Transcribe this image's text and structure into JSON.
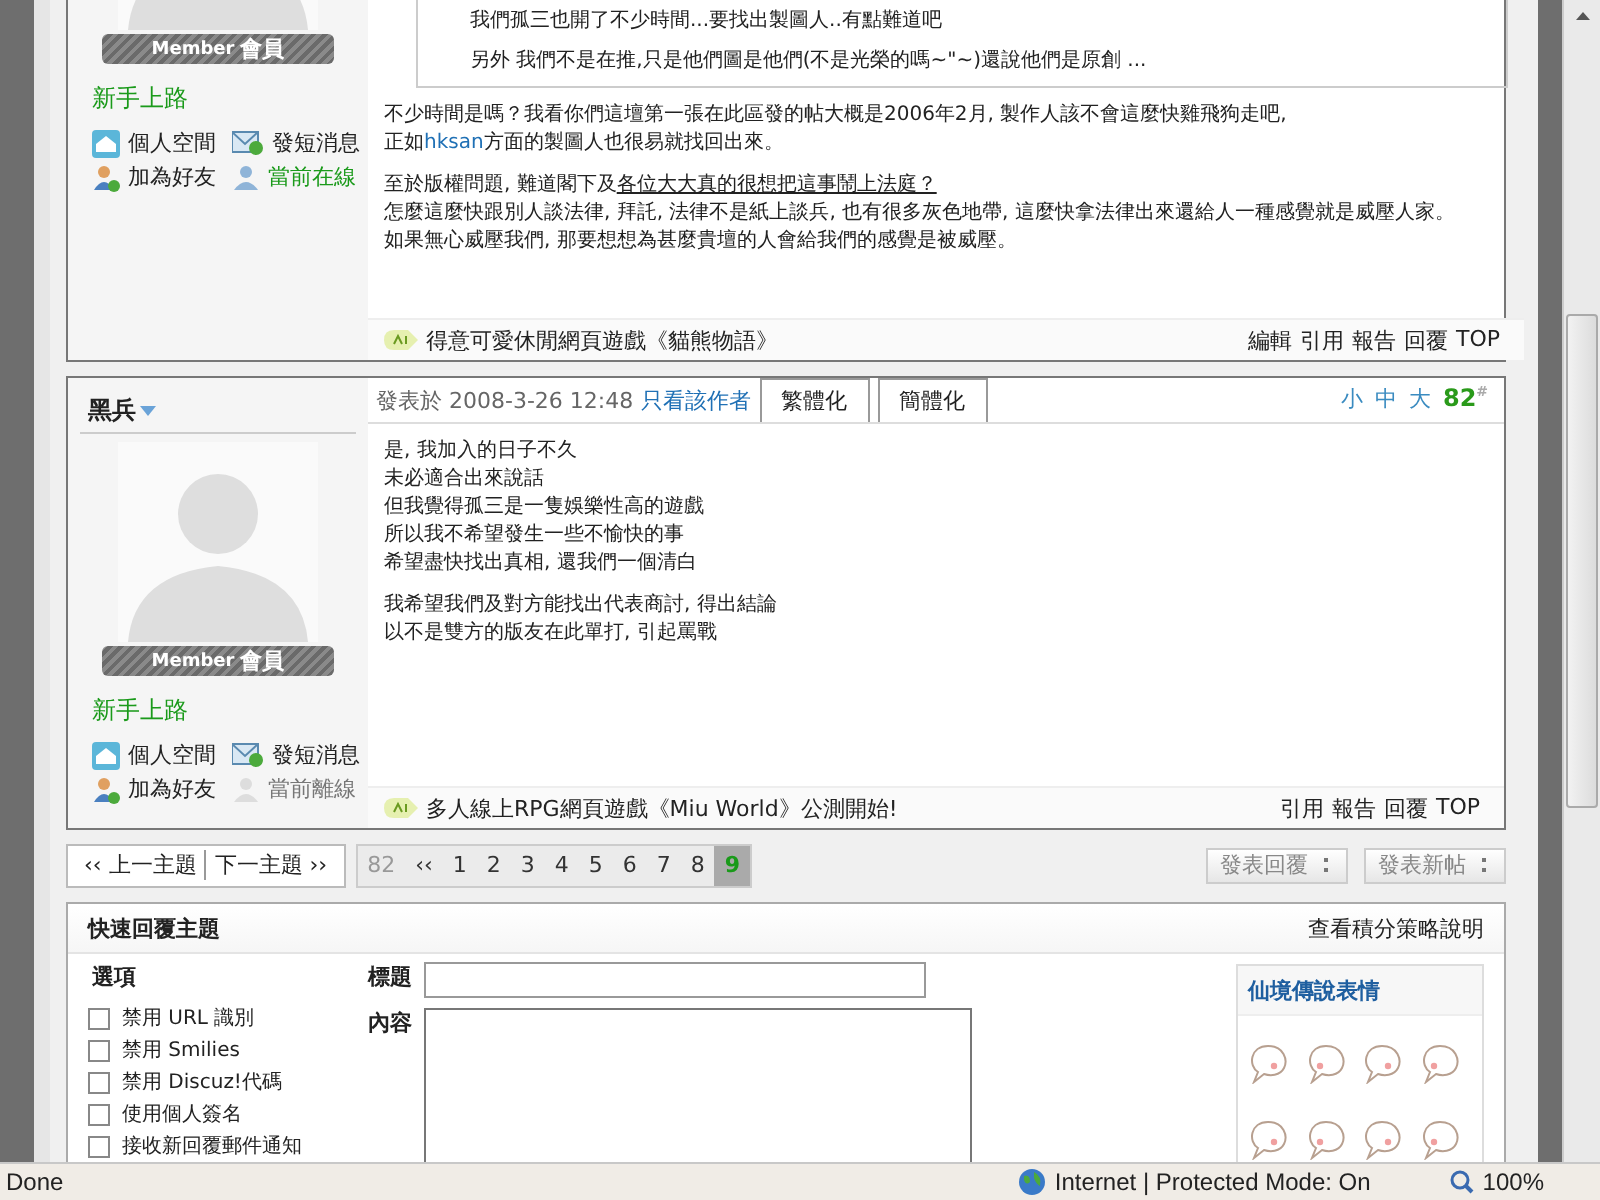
{
  "posts": [
    {
      "sidebar": {
        "badge_role": "Member",
        "badge_label": "會員",
        "rank": "新手上路",
        "links": [
          {
            "kind": "space",
            "label": "個人空間"
          },
          {
            "kind": "message",
            "label": "發短消息"
          },
          {
            "kind": "friend",
            "label": "加為好友"
          },
          {
            "kind": "status",
            "label": "當前在線",
            "online": true
          }
        ]
      },
      "quote_lines": [
        "我們孤三也開了不少時間...要找出製圖人..有點難道吧",
        "另外 我們不是在推,只是他們圖是他們(不是光榮的嗎~\"~)還說他們是原創 ..."
      ],
      "paragraphs": [
        [
          [
            {
              "kind": "text",
              "text": "不少時間是嗎？我看你們這壇第一張在此區發的帖大概是2006年2月, 製作人該不會這麼快雞飛狗走吧,"
            }
          ],
          [
            {
              "kind": "text",
              "text": "正如"
            },
            {
              "kind": "highlight",
              "text": "hksan"
            },
            {
              "kind": "text",
              "text": "方面的製圖人也很易就找回出來。"
            }
          ]
        ],
        [
          [
            {
              "kind": "text",
              "text": "至於版權問題, 難道閣下及"
            },
            {
              "kind": "underline",
              "text": "各位大大真的很想把這事鬧上法庭？"
            }
          ],
          [
            {
              "kind": "text",
              "text": "怎麼這麼快跟別人談法律, 拜託, 法律不是紙上談兵, 也有很多灰色地帶, 這麼快拿法律出來還給人一種感覺就是威壓人家。"
            }
          ],
          [
            {
              "kind": "text",
              "text": "如果無心威壓我們, 那要想想為甚麼貴壇的人會給我們的感覺是被威壓。"
            }
          ]
        ]
      ],
      "ad": "得意可愛休閒網頁遊戲《貓熊物語》",
      "actions": [
        "編輯",
        "引用",
        "報告",
        "回覆",
        "TOP"
      ]
    },
    {
      "author": "黑兵",
      "posted": "發表於 2008-3-26 12:48",
      "author_only": "只看該作者",
      "convert_tabs": [
        "繁體化",
        "簡體化"
      ],
      "font_sizes": [
        "小",
        "中",
        "大"
      ],
      "floor": "82",
      "floor_mark": "#",
      "sidebar": {
        "badge_role": "Member",
        "badge_label": "會員",
        "rank": "新手上路",
        "links": [
          {
            "kind": "space",
            "label": "個人空間"
          },
          {
            "kind": "message",
            "label": "發短消息"
          },
          {
            "kind": "friend",
            "label": "加為好友"
          },
          {
            "kind": "status",
            "label": "當前離線",
            "online": false
          }
        ]
      },
      "paragraphs": [
        [
          [
            {
              "kind": "text",
              "text": "是, 我加入的日子不久"
            }
          ],
          [
            {
              "kind": "text",
              "text": "未必適合出來說話"
            }
          ],
          [
            {
              "kind": "text",
              "text": "但我覺得孤三是一隻娛樂性高的遊戲"
            }
          ],
          [
            {
              "kind": "text",
              "text": "所以我不希望發生一些不愉快的事"
            }
          ],
          [
            {
              "kind": "text",
              "text": "希望盡快找出真相, 還我們一個清白"
            }
          ]
        ],
        [
          [
            {
              "kind": "text",
              "text": "我希望我們及對方能找出代表商討, 得出結論"
            }
          ],
          [
            {
              "kind": "text",
              "text": "以不是雙方的版友在此單打, 引起罵戰"
            }
          ]
        ]
      ],
      "ad": "多人線上RPG網頁遊戲《Miu World》公測開始!",
      "actions": [
        "引用",
        "報告",
        "回覆",
        "TOP"
      ]
    }
  ],
  "thread_nav": {
    "prev": "‹‹ 上一主題",
    "next": "下一主題 ››"
  },
  "pagination": {
    "total": "82",
    "first": "‹‹",
    "pages": [
      {
        "label": "1",
        "selected": false
      },
      {
        "label": "2",
        "selected": false
      },
      {
        "label": "3",
        "selected": false
      },
      {
        "label": "4",
        "selected": false
      },
      {
        "label": "5",
        "selected": false
      },
      {
        "label": "6",
        "selected": false
      },
      {
        "label": "7",
        "selected": false
      },
      {
        "label": "8",
        "selected": false
      },
      {
        "label": "9",
        "selected": true
      }
    ]
  },
  "post_buttons": [
    "發表回覆",
    "發表新帖"
  ],
  "quick_reply": {
    "title": "快速回覆主題",
    "credits_link": "查看積分策略說明",
    "options_title": "選項",
    "options": [
      {
        "label": "禁用 URL 識別",
        "checked": false
      },
      {
        "label": "禁用 Smilies",
        "checked": false
      },
      {
        "label": "禁用 Discuz!代碼",
        "checked": false
      },
      {
        "label": "使用個人簽名",
        "checked": false
      },
      {
        "label": "接收新回覆郵件通知",
        "checked": false
      }
    ],
    "subject_label": "標題",
    "content_label": "內容",
    "smilies_title": "仙境傳說表情"
  },
  "status_bar": {
    "text": "Done",
    "zone": "Internet | Protected Mode: On",
    "zoom": "100%"
  }
}
